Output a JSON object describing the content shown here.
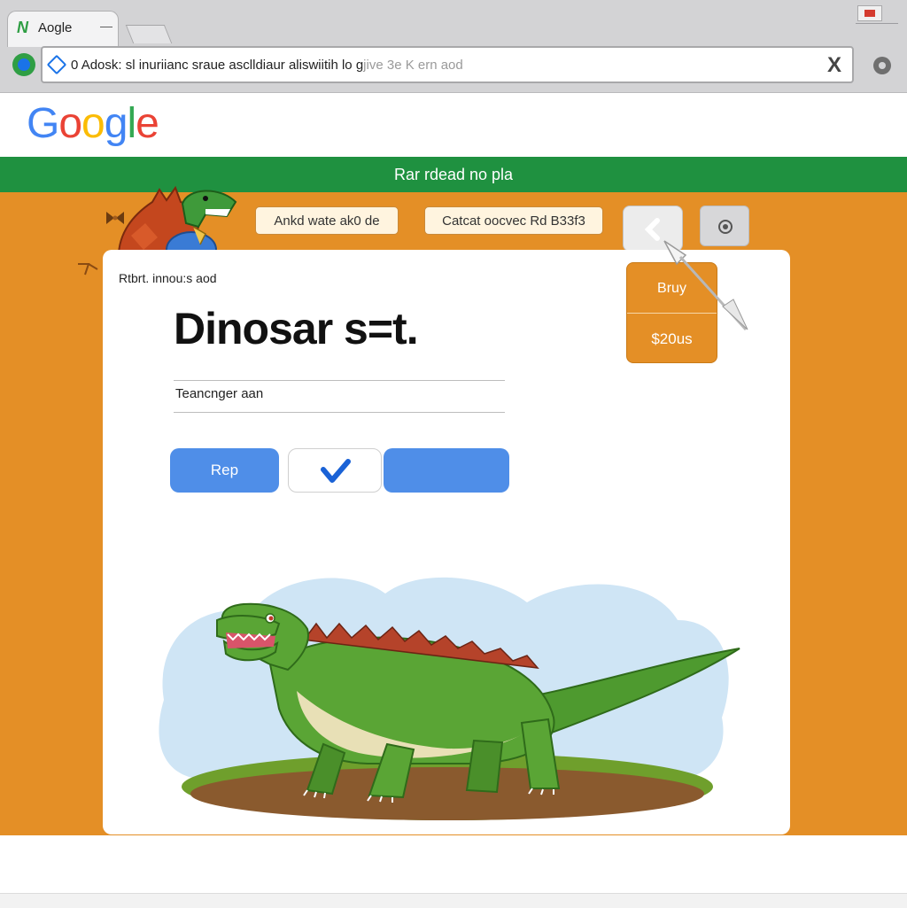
{
  "browser": {
    "tab_title": "Aogle",
    "tab_logo": "N",
    "tab_close": "—",
    "address_text": "Adosk: sl inuriianc sraue asclldiaur aliswiitih lo g",
    "address_faded": "jive 3e K ern aod",
    "address_prefix": "0",
    "close_glyph": "X"
  },
  "header": {
    "logo_letters": [
      "G",
      "o",
      "o",
      "g",
      "l",
      "e"
    ],
    "logo_colors": [
      "#4285f4",
      "#ea4335",
      "#fbbc05",
      "#4285f4",
      "#34a853",
      "#ea4335"
    ],
    "banner_text": "Rar rdead no pla"
  },
  "toolbar": {
    "pill_1": "Ankd wate ak0 de",
    "pill_2": "Catcat oocvec Rd B33f3"
  },
  "card": {
    "caption": "Rtbrt. innou:s aod",
    "title": "Dinosar s=t.",
    "field_value": "Teancnger aan",
    "button_rep": "Rep",
    "button_wide": ""
  },
  "dropdown": {
    "buy": "Bruy",
    "price": "$20us"
  },
  "colors": {
    "accent_orange": "#e48f26",
    "banner_green": "#1f9140",
    "button_blue": "#4f8ee8"
  }
}
